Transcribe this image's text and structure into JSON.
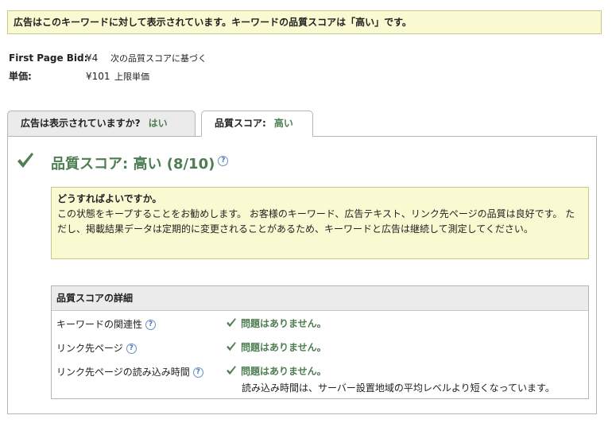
{
  "banner": {
    "text": "広告はこのキーワードに対して表示されています。キーワードの品質スコアは「高い」です。"
  },
  "bids": [
    {
      "label": "First Page Bid:",
      "value": "¥4",
      "note": "次の品質スコアに基づく"
    },
    {
      "label": "単価:",
      "value": "¥101",
      "note": "上限単価"
    }
  ],
  "tabs": [
    {
      "label": "広告は表示されていますか?",
      "answer": "はい"
    },
    {
      "label": "品質スコア:",
      "answer": "高い"
    }
  ],
  "score": {
    "title": "品質スコア: 高い (8/10)",
    "help_icon": "question-circle-icon",
    "check_icon": "checkmark-icon"
  },
  "advice": {
    "heading": "どうすればよいですか。",
    "body": "この状態をキープすることをお勧めします。 お客様のキーワード、広告テキスト、リンク先ページの品質は良好です。 ただし、掲載結果データは定期的に変更されることがあるため、キーワードと広告は継続して測定してください。"
  },
  "details": {
    "heading": "品質スコアの詳細",
    "rows": [
      {
        "label": "キーワードの関連性",
        "status": "問題はありません。"
      },
      {
        "label": "リンク先ページ",
        "status": "問題はありません。"
      },
      {
        "label": "リンク先ページの読み込み時間",
        "status": "問題はありません。",
        "subtext": "読み込み時間は、サーバー設置地域の平均レベルより短くなっています。"
      }
    ]
  },
  "colors": {
    "accent_green": "#4e7e52",
    "banner_bg": "#fafad2",
    "help_blue": "#4a76b8"
  }
}
